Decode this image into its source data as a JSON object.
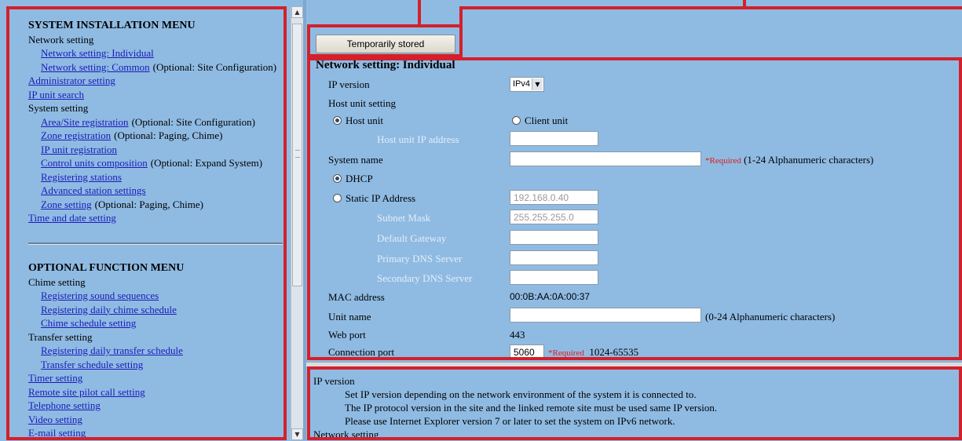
{
  "system_menu": {
    "title": "SYSTEM INSTALLATION MENU",
    "items": [
      {
        "label": "Network setting",
        "link": false,
        "level": 1
      },
      {
        "label": "Network setting: Individual",
        "link": true,
        "level": 2
      },
      {
        "label": "Network setting: Common",
        "link": true,
        "level": 2,
        "note": "(Optional: Site Configuration)"
      },
      {
        "label": "Administrator setting",
        "link": true,
        "level": 1
      },
      {
        "label": "IP unit search",
        "link": true,
        "level": 1
      },
      {
        "label": "System setting",
        "link": false,
        "level": 1
      },
      {
        "label": "Area/Site registration",
        "link": true,
        "level": 2,
        "note": "(Optional: Site Configuration)"
      },
      {
        "label": "Zone registration",
        "link": true,
        "level": 2,
        "note": "(Optional: Paging, Chime)"
      },
      {
        "label": "IP unit registration",
        "link": true,
        "level": 2
      },
      {
        "label": "Control units composition",
        "link": true,
        "level": 2,
        "note": "(Optional: Expand System)"
      },
      {
        "label": "Registering stations",
        "link": true,
        "level": 2
      },
      {
        "label": "Advanced station settings",
        "link": true,
        "level": 2
      },
      {
        "label": "Zone setting",
        "link": true,
        "level": 2,
        "note": "(Optional: Paging, Chime)"
      },
      {
        "label": "Time and date setting",
        "link": true,
        "level": 1
      }
    ]
  },
  "optional_menu": {
    "title": "OPTIONAL FUNCTION MENU",
    "items": [
      {
        "label": "Chime setting",
        "link": false,
        "level": 1
      },
      {
        "label": "Registering sound sequences",
        "link": true,
        "level": 2
      },
      {
        "label": "Registering daily chime schedule",
        "link": true,
        "level": 2
      },
      {
        "label": "Chime schedule setting",
        "link": true,
        "level": 2
      },
      {
        "label": "Transfer setting",
        "link": false,
        "level": 1
      },
      {
        "label": "Registering daily transfer schedule",
        "link": true,
        "level": 2
      },
      {
        "label": "Transfer schedule setting",
        "link": true,
        "level": 2
      },
      {
        "label": "Timer setting",
        "link": true,
        "level": 1
      },
      {
        "label": "Remote site pilot call setting",
        "link": true,
        "level": 1
      },
      {
        "label": "Telephone setting",
        "link": true,
        "level": 1
      },
      {
        "label": "Video setting",
        "link": true,
        "level": 1
      },
      {
        "label": "E-mail setting",
        "link": true,
        "level": 1
      }
    ]
  },
  "toolbar": {
    "stored_label": "Temporarily stored"
  },
  "form": {
    "title": "Network setting: Individual",
    "ip_version_label": "IP version",
    "ip_version_value": "IPv4",
    "host_unit_setting_label": "Host unit setting",
    "host_unit_option": "Host unit",
    "client_unit_option": "Client unit",
    "host_unit_ip_label": "Host unit IP address",
    "host_unit_ip_value": "",
    "system_name_label": "System name",
    "system_name_value": "",
    "required_text": "*Required",
    "system_name_hint": "(1-24 Alphanumeric characters)",
    "dhcp_option": "DHCP",
    "static_option": "Static IP Address",
    "static_ip_value": "192.168.0.40",
    "subnet_label": "Subnet Mask",
    "subnet_value": "255.255.255.0",
    "gateway_label": "Default Gateway",
    "gateway_value": "",
    "primary_dns_label": "Primary DNS Server",
    "primary_dns_value": "",
    "secondary_dns_label": "Secondary DNS Server",
    "secondary_dns_value": "",
    "mac_label": "MAC address",
    "mac_value": "00:0B:AA:0A:00:37",
    "unit_name_label": "Unit name",
    "unit_name_value": "",
    "unit_name_hint": "(0-24 Alphanumeric characters)",
    "web_port_label": "Web port",
    "web_port_value": "443",
    "conn_port_label": "Connection port",
    "conn_port_value": "5060",
    "conn_port_range": "1024-65535"
  },
  "help": {
    "heading1": "IP version",
    "lines": [
      "Set IP version depending on the network environment of the system it is connected to.",
      "The IP protocol version in the site and the linked remote site must be used same IP version.",
      "Please use Internet Explorer version 7 or later to set the system on IPv6 network."
    ],
    "heading2": "Network setting"
  },
  "colors": {
    "background": "#8fbbe3",
    "link": "#1a1ab8",
    "highlight_box": "#d4202a",
    "required": "#e01b1b"
  }
}
